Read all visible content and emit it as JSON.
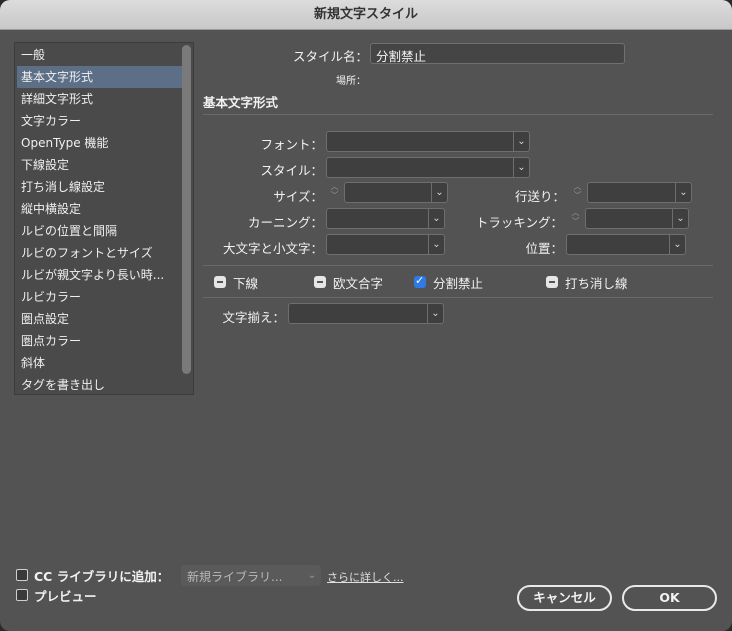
{
  "window": {
    "title": "新規文字スタイル"
  },
  "categories": [
    "一般",
    "基本文字形式",
    "詳細文字形式",
    "文字カラー",
    "OpenType 機能",
    "下線設定",
    "打ち消し線設定",
    "縦中横設定",
    "ルビの位置と間隔",
    "ルビのフォントとサイズ",
    "ルビが親文字より長い時...",
    "ルビカラー",
    "圏点設定",
    "圏点カラー",
    "斜体",
    "タグを書き出し"
  ],
  "selected_category": "基本文字形式",
  "style_name": {
    "label": "スタイル名：",
    "value": "分割禁止"
  },
  "location": {
    "label": "場所："
  },
  "section_title": "基本文字形式",
  "fields": {
    "font": "フォント：",
    "style": "スタイル：",
    "size": "サイズ：",
    "leading": "行送り：",
    "kerning": "カーニング：",
    "tracking": "トラッキング：",
    "case": "大文字と小文字：",
    "position": "位置："
  },
  "checkboxes": [
    {
      "label": "下線",
      "state": "mixed"
    },
    {
      "label": "欧文合字",
      "state": "mixed"
    },
    {
      "label": "分割禁止",
      "state": "checked"
    },
    {
      "label": "打ち消し線",
      "state": "mixed"
    }
  ],
  "alignment": {
    "label": "文字揃え："
  },
  "footer": {
    "cc_library_label": "CC ライブラリに追加：",
    "library_value": "新規ライブラリ...",
    "learn_more": "さらに詳しく...",
    "preview_label": "プレビュー",
    "cancel": "キャンセル",
    "ok": "OK"
  },
  "colors": {
    "selection": "#5c6f86",
    "checkbox_on": "#2f7ae5"
  }
}
